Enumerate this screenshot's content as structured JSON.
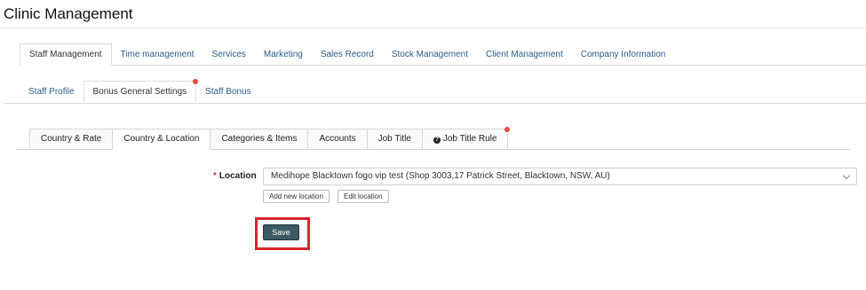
{
  "page": {
    "title": "Clinic Management"
  },
  "main_tabs": [
    "Staff Management",
    "Time management",
    "Services",
    "Marketing",
    "Sales Record",
    "Stock Management",
    "Client Management",
    "Company Information"
  ],
  "sub_tabs": [
    "Staff Profile",
    "Bonus General Settings",
    "Staff Bonus"
  ],
  "box_tabs": [
    "Country & Rate",
    "Country & Location",
    "Categories & Items",
    "Accounts",
    "Job Title",
    "Job Title Rule"
  ],
  "location": {
    "required_mark": "*",
    "label": "Location",
    "selected": "Medihope Blacktown fogo vip test (Shop 3003,17 Patrick Street, Blacktown, NSW, AU)"
  },
  "buttons": {
    "add_location": "Add new location",
    "edit_location": "Edit location",
    "save": "Save"
  },
  "colors": {
    "link": "#2b5d8c",
    "notification_dot": "#e74c3c",
    "save_button": "#3b5a63",
    "highlight_box": "#d6262b"
  }
}
